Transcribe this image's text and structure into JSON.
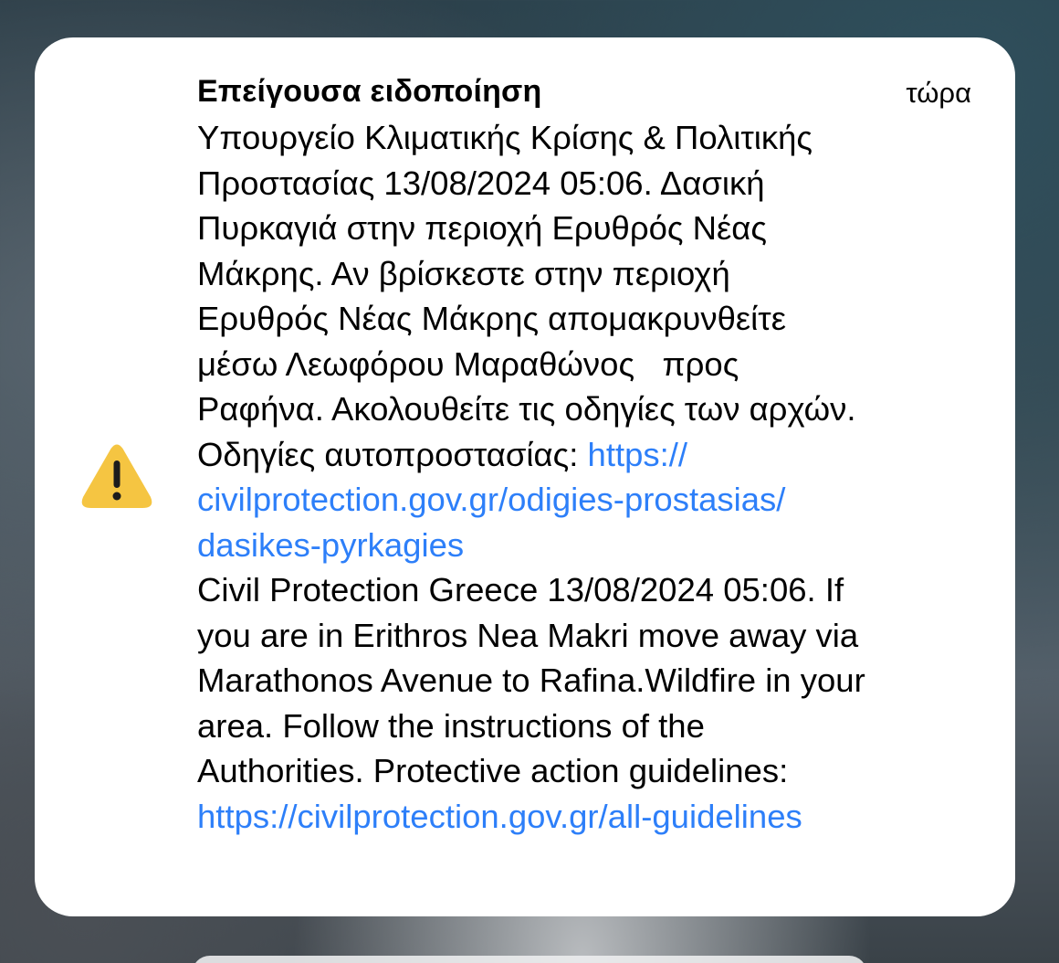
{
  "notification": {
    "title": "Επείγουσα ειδοποίηση",
    "time": "τώρα",
    "icon": "warning-triangle-icon",
    "accent_color": "#f5c542",
    "link_color": "#2d7ff9",
    "greek_lines": [
      "Υπουργείο Κλιματικής Κρίσης & Πολιτικής",
      "Προστασίας 13/08/2024 05:06. Δασική",
      "Πυρκαγιά στην περιοχή Ερυθρός Νέας",
      "Μάκρης. Αν βρίσκεστε στην περιοχή",
      "Ερυθρός Νέας Μάκρης απομακρυνθείτε",
      "μέσω Λεωφόρου Μαραθώνος   προς",
      "Ραφήνα. Ακολουθείτε τις οδηγίες των αρχών."
    ],
    "guidelines_label": "Οδηγίες αυτοπροστασίας: ",
    "greek_link_lines": [
      "https://",
      "civilprotection.gov.gr/odigies-prostasias/",
      "dasikes-pyrkagies"
    ],
    "english_lines": [
      "Civil Protection Greece 13/08/2024 05:06. If",
      "you are in Erithros Nea Makri move away via",
      "Marathonos Avenue to Rafina.Wildfire in your",
      "area. Follow the instructions of the",
      "Authorities. Protective action guidelines:"
    ],
    "english_link": "https://civilprotection.gov.gr/all-guidelines"
  }
}
